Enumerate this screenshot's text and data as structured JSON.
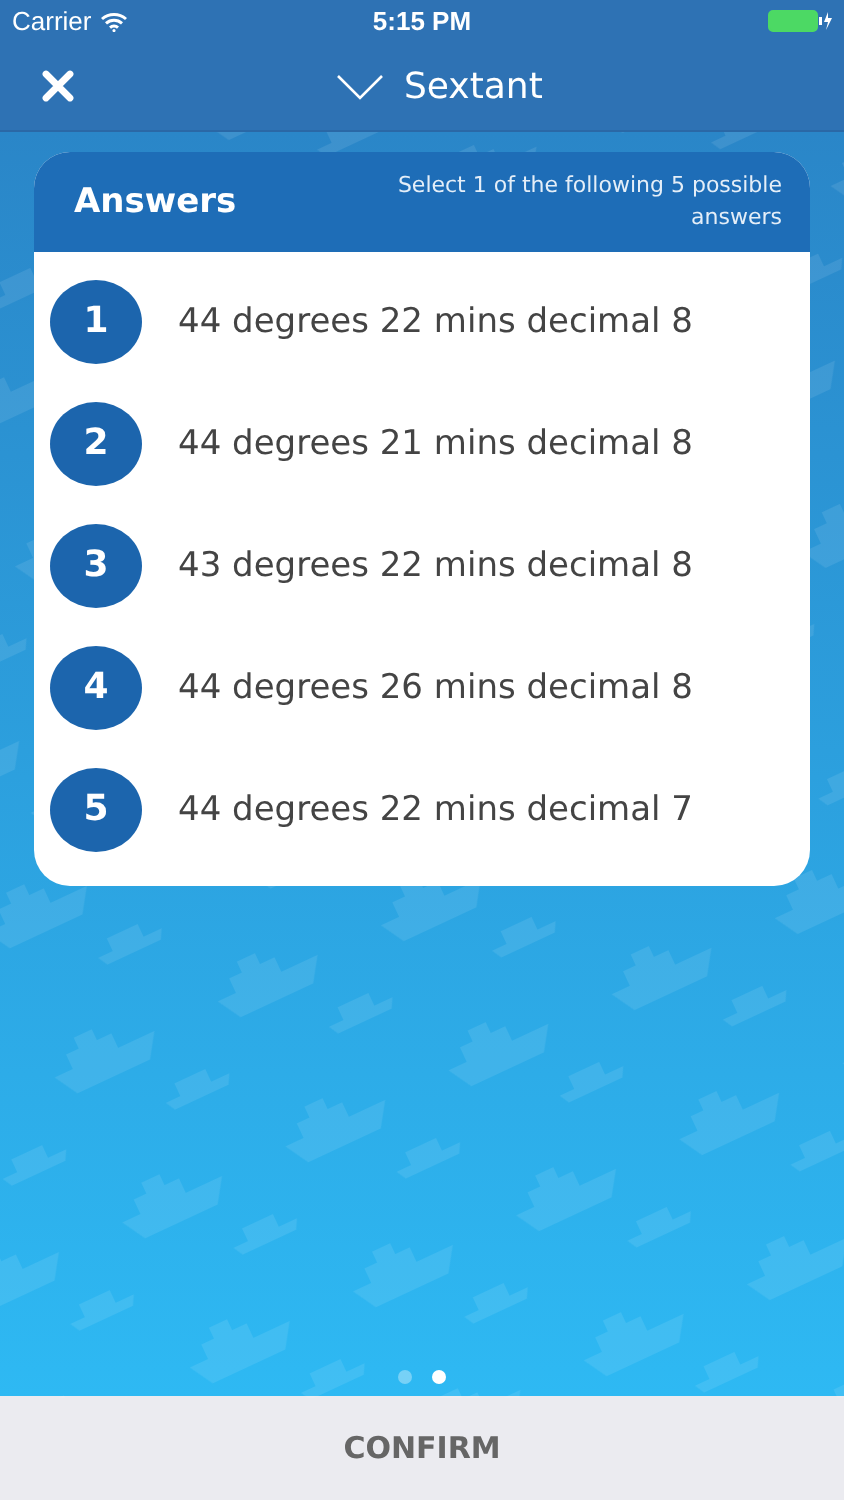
{
  "status_bar": {
    "carrier": "Carrier",
    "time": "5:15 PM"
  },
  "nav": {
    "title": "Sextant"
  },
  "answers": {
    "title": "Answers",
    "instruction": "Select 1 of the following 5 possible answers",
    "items": [
      {
        "number": "1",
        "text": "44 degrees 22 mins decimal 8"
      },
      {
        "number": "2",
        "text": "44 degrees 21 mins decimal 8"
      },
      {
        "number": "3",
        "text": "43 degrees 22 mins decimal 8"
      },
      {
        "number": "4",
        "text": "44 degrees 26 mins decimal 8"
      },
      {
        "number": "5",
        "text": "44 degrees 22 mins decimal 7"
      }
    ]
  },
  "page_dots": [
    {
      "selected": false
    },
    {
      "selected": true
    }
  ],
  "confirm_button": "CONFIRM"
}
